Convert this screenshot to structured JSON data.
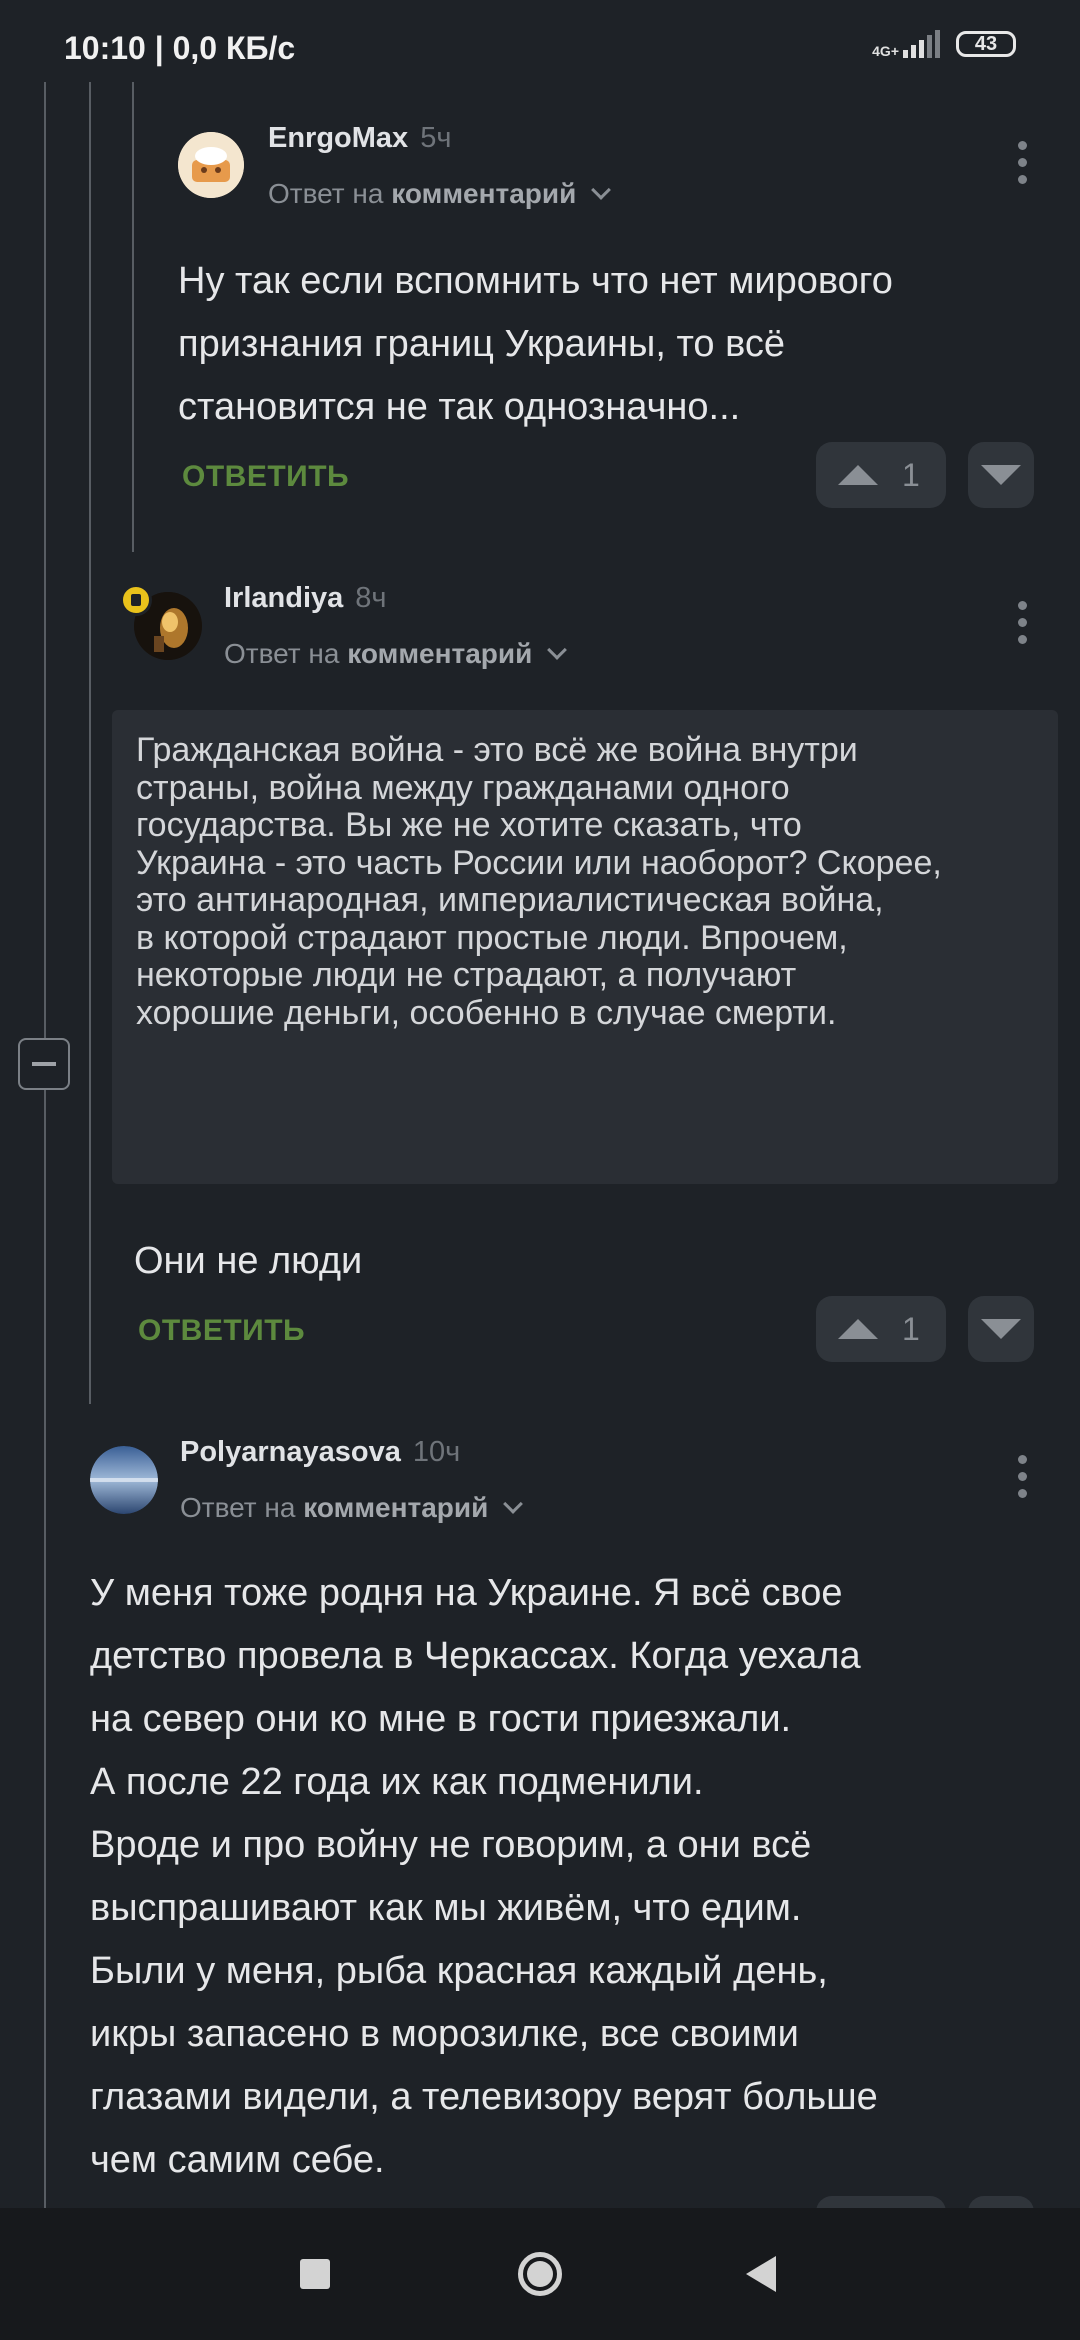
{
  "status_bar": {
    "time": "10:10",
    "speed": "| 0,0 КБ/с",
    "network": "4G+",
    "battery": "43"
  },
  "comments": [
    {
      "username": "EnrgoMax",
      "time": "5ч",
      "reply_prefix": "Ответ на",
      "reply_target": "комментарий",
      "text_lines": [
        "Ну так если вспомнить что нет мирового",
        "признания границ Украины, то всё",
        "становится не так однозначно..."
      ],
      "reply_label": "ОТВЕТИТЬ",
      "votes": "1"
    },
    {
      "username": "Irlandiya",
      "time": "8ч",
      "reply_prefix": "Ответ на",
      "reply_target": "комментарий",
      "quote_lines": [
        "Гражданская война - это всё же война внутри",
        "страны, война между гражданами одного",
        "государства. Вы же не хотите сказать, что",
        "Украина - это часть России или наоборот? Скорее,",
        "это антинародная, империалистическая война,",
        "в которой страдают простые люди. Впрочем,",
        "некоторые люди не страдают, а получают",
        "хорошие деньги, особенно в случае смерти."
      ],
      "text": "Они не люди",
      "reply_label": "ОТВЕТИТЬ",
      "votes": "1"
    },
    {
      "username": "Polyarnayasova",
      "time": "10ч",
      "reply_prefix": "Ответ на",
      "reply_target": "комментарий",
      "text_lines": [
        "У меня тоже родня на Украине. Я всё свое",
        "детство провела в Черкассах. Когда уехала",
        "на север они ко мне в гости приезжали.",
        "А после 22 года их как подменили.",
        "Вроде и про войну не говорим, а они всё",
        "выспрашивают как мы живём, что едим.",
        "Были у меня, рыба красная каждый день,",
        "икры запасено в морозилке, все своими",
        "глазами видели, а телевизору верят больше",
        "чем самим себе."
      ]
    }
  ],
  "colors": {
    "background": "#1e2227",
    "reply_green": "#5d8a3e",
    "vote_bg": "#30353b"
  }
}
